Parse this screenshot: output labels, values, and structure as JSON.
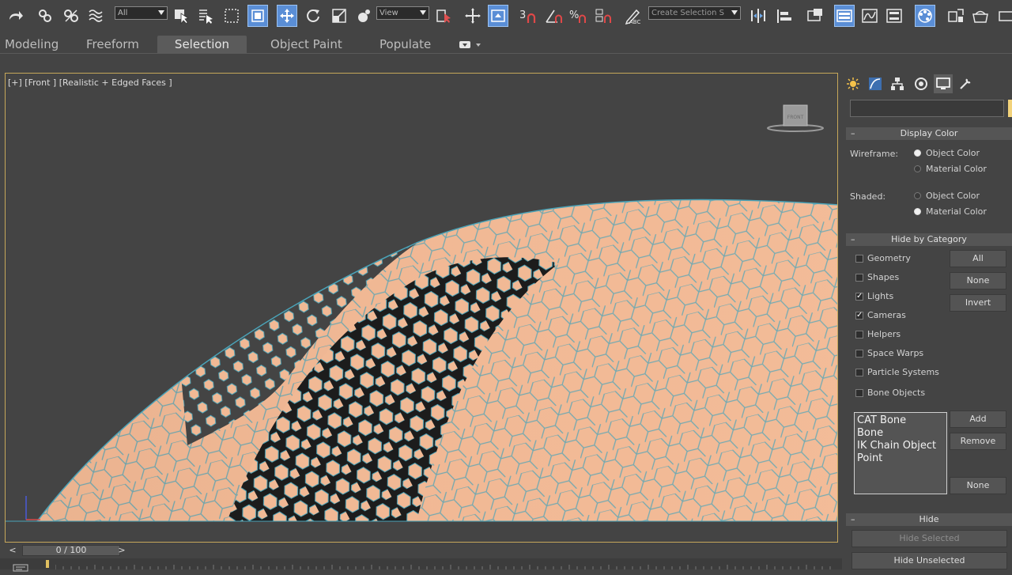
{
  "toolbar": {
    "selection_filter": "All",
    "reference_coord": "View",
    "named_selection_placeholder": "Create Selection S",
    "icons": [
      "redo-icon",
      "link-icon",
      "unlink-icon",
      "bind-spacewarp-icon",
      "select-object-icon",
      "select-by-name-icon",
      "rect-select-region-icon",
      "window-crossing-icon",
      "move-icon",
      "rotate-icon",
      "scale-icon",
      "placement-icon",
      "select-manipulate-icon",
      "keyboard-shortcut-override-icon",
      "snaps-toggle-icon",
      "angle-snap-icon",
      "percent-snap-icon",
      "spinner-snap-icon",
      "edit-named-selection-icon",
      "mirror-icon",
      "align-icon",
      "toggle-scene-explorer-icon",
      "toggle-layer-explorer-icon",
      "curve-editor-icon",
      "schematic-view-icon",
      "material-editor-icon",
      "render-setup-icon",
      "rendered-frame-window-icon",
      "render-production-icon"
    ]
  },
  "ribbon": {
    "tabs": [
      "Modeling",
      "Freeform",
      "Selection",
      "Object Paint",
      "Populate"
    ],
    "selected": "Selection"
  },
  "viewport": {
    "label": "[+] [Front ] [Realistic + Edged Faces ]",
    "viewcube_face": "FRONT"
  },
  "command_panel": {
    "tabs": [
      "create-icon",
      "modify-icon",
      "hierarchy-icon",
      "motion-icon",
      "display-icon",
      "utilities-icon"
    ],
    "selected_tab": "display-icon",
    "display_color": {
      "title": "Display Color",
      "wireframe_label": "Wireframe:",
      "shaded_label": "Shaded:",
      "object_color": "Object Color",
      "material_color": "Material Color",
      "wireframe_selected": "Object Color",
      "shaded_selected": "Material Color"
    },
    "hide_by_category": {
      "title": "Hide by Category",
      "items": [
        {
          "label": "Geometry",
          "checked": false
        },
        {
          "label": "Shapes",
          "checked": false
        },
        {
          "label": "Lights",
          "checked": true
        },
        {
          "label": "Cameras",
          "checked": true
        },
        {
          "label": "Helpers",
          "checked": false
        },
        {
          "label": "Space Warps",
          "checked": false
        },
        {
          "label": "Particle Systems",
          "checked": false
        },
        {
          "label": "Bone Objects",
          "checked": false
        }
      ],
      "btn_all": "All",
      "btn_none": "None",
      "btn_invert": "Invert",
      "list_items": [
        "CAT Bone",
        "Bone",
        "IK Chain Object",
        "Point"
      ],
      "btn_add": "Add",
      "btn_remove": "Remove",
      "btn_none2": "None"
    },
    "hide": {
      "title": "Hide",
      "btn_hide_selected": "Hide Selected",
      "btn_hide_unselected": "Hide Unselected"
    }
  },
  "timeline": {
    "frame_readout": "0 / 100"
  },
  "colors": {
    "mesh_fill": "#f1b995",
    "mesh_edge": "#4aa3b8",
    "viewport_border": "#c6a75a",
    "active_button": "#5a8ed6"
  }
}
